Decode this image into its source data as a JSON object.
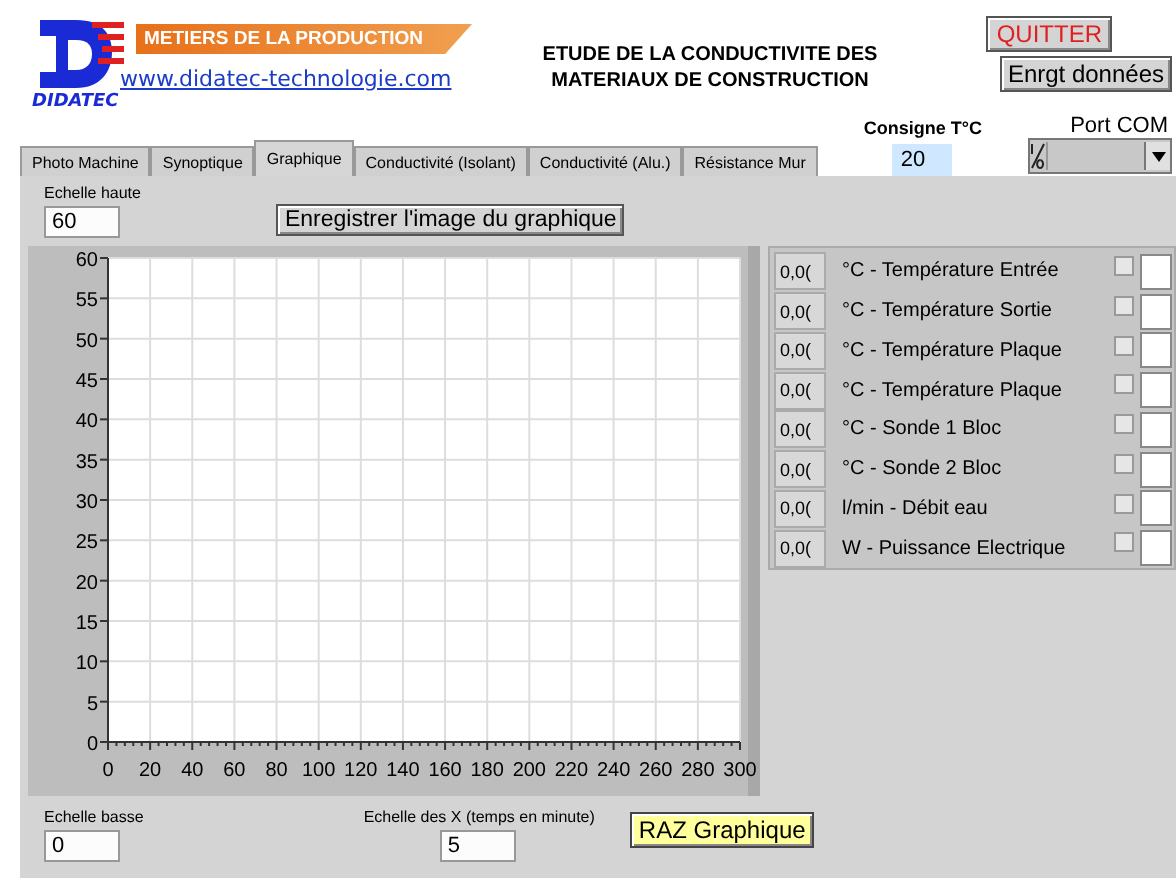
{
  "brand": {
    "banner": "METIERS DE LA PRODUCTION",
    "link": "www.didatec-technologie.com",
    "name": "DIDATEC"
  },
  "title": "ETUDE DE LA CONDUCTIVITE DES MATERIAUX DE CONSTRUCTION",
  "buttons": {
    "quit": "QUITTER",
    "save_data": "Enrgt données"
  },
  "setpoint": {
    "label": "Consigne T°C",
    "value": "20"
  },
  "port_com": {
    "label": "Port COM"
  },
  "tabs": [
    {
      "label": "Photo Machine",
      "selected": false
    },
    {
      "label": "Synoptique",
      "selected": false
    },
    {
      "label": "Graphique",
      "selected": true
    },
    {
      "label": "Conductivité (Isolant)",
      "selected": false
    },
    {
      "label": "Conductivité (Alu.)",
      "selected": false
    },
    {
      "label": "Résistance Mur",
      "selected": false
    }
  ],
  "high_scale": {
    "label": "Echelle haute",
    "value": "60"
  },
  "save_image_button": "Enregistrer l'image du graphique",
  "chart_data": {
    "type": "line",
    "grid": true,
    "xlim": [
      0,
      300
    ],
    "ylim": [
      0,
      60
    ],
    "xticks": [
      0,
      20,
      40,
      60,
      80,
      100,
      120,
      140,
      160,
      180,
      200,
      220,
      240,
      260,
      280,
      300
    ],
    "yticks": [
      0,
      5,
      10,
      15,
      20,
      25,
      30,
      35,
      40,
      45,
      50,
      55,
      60
    ]
  },
  "channels": [
    {
      "value": "0,0(",
      "label": "°C - Température Entrée",
      "checked": false
    },
    {
      "value": "0,0(",
      "label": "°C - Température Sortie",
      "checked": false
    },
    {
      "value": "0,0(",
      "label": "°C - Température Plaque",
      "checked": false
    },
    {
      "value": "0,0(",
      "label": "°C - Température Plaque",
      "checked": false
    },
    {
      "value": "0,0(",
      "label": "°C - Sonde 1 Bloc",
      "checked": false
    },
    {
      "value": "0,0(",
      "label": "°C - Sonde 2 Bloc",
      "checked": false
    },
    {
      "value": "0,0(",
      "label": "l/min - Débit eau",
      "checked": false
    },
    {
      "value": "0,0(",
      "label": "W - Puissance Electrique",
      "checked": false
    }
  ],
  "low_scale": {
    "label": "Echelle basse",
    "value": "0"
  },
  "x_scale": {
    "label": "Echelle des X (temps en minute)",
    "value": "5"
  },
  "reset_button": "RAZ Graphique"
}
